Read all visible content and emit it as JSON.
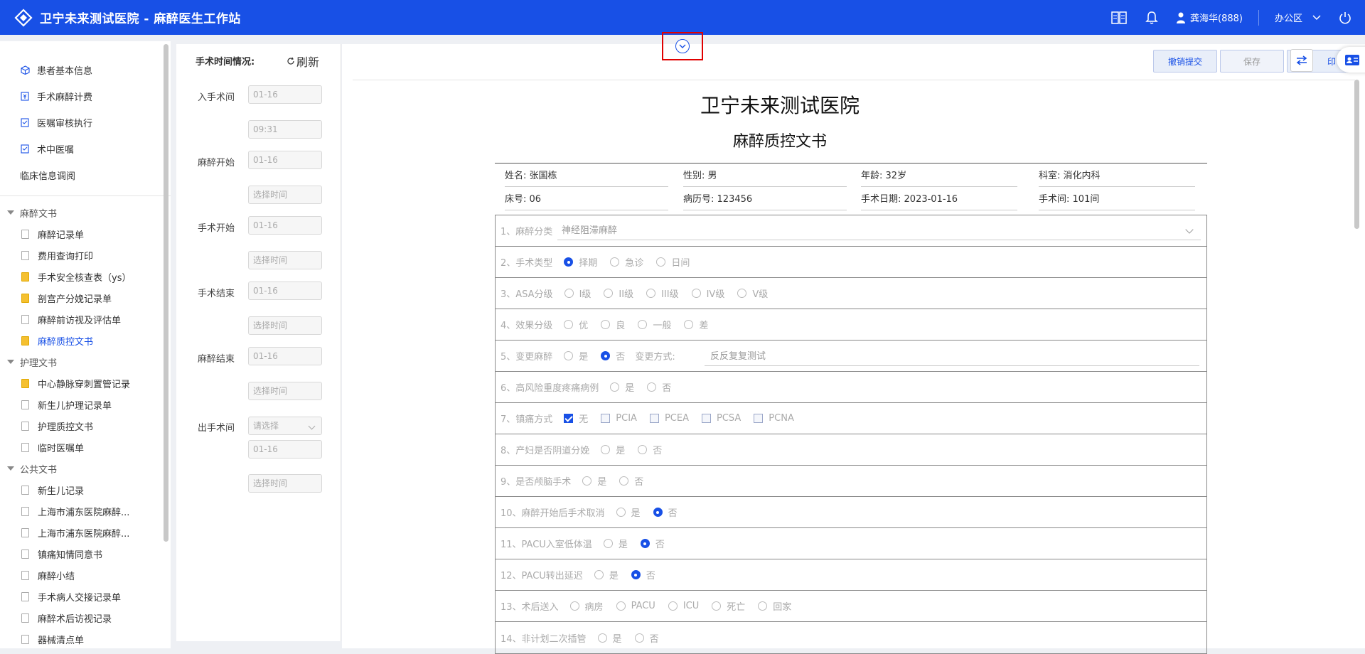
{
  "header": {
    "title": "卫宁未来测试医院 - 麻醉医生工作站",
    "user": "龚海华(888)",
    "area": "办公区"
  },
  "sidebar": {
    "top_items": [
      {
        "label": "患者基本信息",
        "icon": "cube-icon"
      },
      {
        "label": "手术麻醉计费",
        "icon": "bill-icon"
      },
      {
        "label": "医嘱审核执行",
        "icon": "checklist-icon"
      },
      {
        "label": "术中医嘱",
        "icon": "checklist-icon"
      },
      {
        "label": "临床信息调阅",
        "icon": ""
      }
    ],
    "groups": [
      {
        "label": "麻醉文书",
        "items": [
          {
            "label": "麻醉记录单",
            "yellow": false
          },
          {
            "label": "费用查询打印",
            "yellow": false
          },
          {
            "label": "手术安全核查表（ys）",
            "yellow": true
          },
          {
            "label": "剖宫产分娩记录单",
            "yellow": true
          },
          {
            "label": "麻醉前访视及评估单",
            "yellow": false
          },
          {
            "label": "麻醉质控文书",
            "yellow": true
          }
        ]
      },
      {
        "label": "护理文书",
        "items": [
          {
            "label": "中心静脉穿刺置管记录",
            "yellow": true
          },
          {
            "label": "新生儿护理记录单",
            "yellow": false
          },
          {
            "label": "护理质控文书",
            "yellow": false
          },
          {
            "label": "临时医嘱单",
            "yellow": false
          }
        ]
      },
      {
        "label": "公共文书",
        "items": [
          {
            "label": "新生儿记录",
            "yellow": false
          },
          {
            "label": "上海市浦东医院麻醉...",
            "yellow": false
          },
          {
            "label": "上海市浦东医院麻醉...",
            "yellow": false
          },
          {
            "label": "镇痛知情同意书",
            "yellow": false
          },
          {
            "label": "麻醉小结",
            "yellow": false
          },
          {
            "label": "手术病人交接记录单",
            "yellow": false
          },
          {
            "label": "麻醉术后访视记录",
            "yellow": false
          },
          {
            "label": "器械清点单",
            "yellow": false
          }
        ]
      }
    ]
  },
  "time_panel": {
    "heading": "手术时间情况:",
    "refresh": "刷新",
    "labels": {
      "enter_room": "入手术间",
      "anes_start": "麻醉开始",
      "op_start": "手术开始",
      "op_end": "手术结束",
      "anes_end": "麻醉结束",
      "leave_room": "出手术间"
    },
    "values": {
      "enter_date": "01-16",
      "enter_time": "09:31",
      "anes_start_date": "01-16",
      "anes_start_time": "选择时间",
      "op_start_date": "01-16",
      "op_start_time": "选择时间",
      "op_end_date": "01-16",
      "op_end_time": "选择时间",
      "anes_end_date": "01-16",
      "anes_end_time": "选择时间",
      "leave_select": "请选择",
      "leave_date": "01-16",
      "leave_time": "选择时间"
    }
  },
  "toolbar": {
    "revoke": "撤销提交",
    "save": "保存",
    "print": "印"
  },
  "document": {
    "hospital": "卫宁未来测试医院",
    "title": "麻醉质控文书",
    "info": {
      "name_label": "姓名:",
      "name": "张国栋",
      "gender_label": "性别:",
      "gender": "男",
      "age_label": "年龄:",
      "age": "32岁",
      "dept_label": "科室:",
      "dept": "消化内科",
      "bed_label": "床号:",
      "bed": "06",
      "record_label": "病历号:",
      "record": "123456",
      "date_label": "手术日期:",
      "date": "2023-01-16",
      "room_label": "手术间:",
      "room": "101间"
    },
    "q1": {
      "label": "1、麻醉分类",
      "value": "神经阻滞麻醉"
    },
    "q2": {
      "label": "2、手术类型",
      "options": [
        "择期",
        "急诊",
        "日间"
      ],
      "selected": 0
    },
    "q3": {
      "label": "3、ASA分级",
      "options": [
        "I级",
        "II级",
        "III级",
        "IV级",
        "V级"
      ],
      "selected": -1
    },
    "q4": {
      "label": "4、效果分级",
      "options": [
        "优",
        "良",
        "一般",
        "差"
      ],
      "selected": -1
    },
    "q5": {
      "label": "5、变更麻醉",
      "options": [
        "是",
        "否"
      ],
      "selected": 1,
      "change_label": "变更方式:",
      "change_value": "反反复复测试"
    },
    "q6": {
      "label": "6、高风险重度疼痛病例",
      "options": [
        "是",
        "否"
      ],
      "selected": -1
    },
    "q7": {
      "label": "7、镇痛方式",
      "options": [
        "无",
        "PCIA",
        "PCEA",
        "PCSA",
        "PCNA"
      ],
      "checked": [
        0
      ]
    },
    "q8": {
      "label": "8、产妇是否阴道分娩",
      "options": [
        "是",
        "否"
      ],
      "selected": -1
    },
    "q9": {
      "label": "9、是否颅脑手术",
      "options": [
        "是",
        "否"
      ],
      "selected": -1
    },
    "q10": {
      "label": "10、麻醉开始后手术取消",
      "options": [
        "是",
        "否"
      ],
      "selected": 1
    },
    "q11": {
      "label": "11、PACU入室低体温",
      "options": [
        "是",
        "否"
      ],
      "selected": 1
    },
    "q12": {
      "label": "12、PACU转出延迟",
      "options": [
        "是",
        "否"
      ],
      "selected": 1
    },
    "q13": {
      "label": "13、术后送入",
      "options": [
        "病房",
        "PACU",
        "ICU",
        "死亡",
        "回家"
      ],
      "selected": -1
    },
    "q14": {
      "label": "14、非计划二次插管",
      "options": [
        "是",
        "否"
      ],
      "selected": -1
    }
  },
  "colors": {
    "brand": "#1850e6",
    "highlight_box": "#e00000",
    "doc_icon_yellow": "#f5c030"
  }
}
